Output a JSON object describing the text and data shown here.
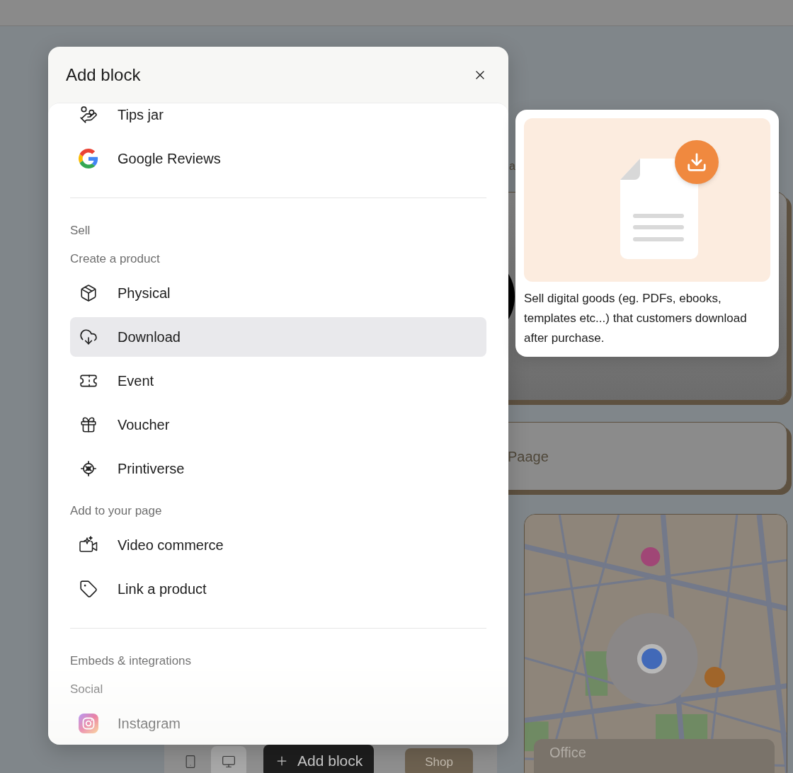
{
  "page": {
    "heading": "a",
    "card_title": "Paage",
    "map": {
      "kind": "picture",
      "place": "Office"
    }
  },
  "toolbar": {
    "devices": [
      {
        "selected": false
      },
      {
        "selected": true
      }
    ],
    "add_button": "Add block",
    "shop_button": "Shop"
  },
  "dialog": {
    "title": "Add block",
    "sections": [
      {
        "groups": [
          {
            "items": [
              {
                "label": "Tips jar",
                "selected": false
              },
              {
                "label": "Google Reviews",
                "selected": false
              }
            ]
          }
        ]
      },
      {
        "heading": "Sell",
        "groups": [
          {
            "subheading": "Create a product",
            "items": [
              {
                "label": "Physical",
                "selected": false
              },
              {
                "label": "Download",
                "selected": true
              },
              {
                "label": "Event",
                "selected": false
              },
              {
                "label": "Voucher",
                "selected": false
              },
              {
                "label": "Printiverse",
                "selected": false
              }
            ]
          },
          {
            "subheading": "Add to your page",
            "items": [
              {
                "label": "Video commerce",
                "selected": false
              },
              {
                "label": "Link a product",
                "selected": false
              }
            ]
          }
        ]
      },
      {
        "heading": "Embeds & integrations",
        "groups": [
          {
            "subheading": "Social",
            "items": [
              {
                "label": "Instagram",
                "selected": false
              }
            ]
          }
        ]
      }
    ]
  },
  "preview": {
    "description": "Sell digital goods (eg. PDFs, ebooks, templates etc...) that customers download after purchase."
  }
}
